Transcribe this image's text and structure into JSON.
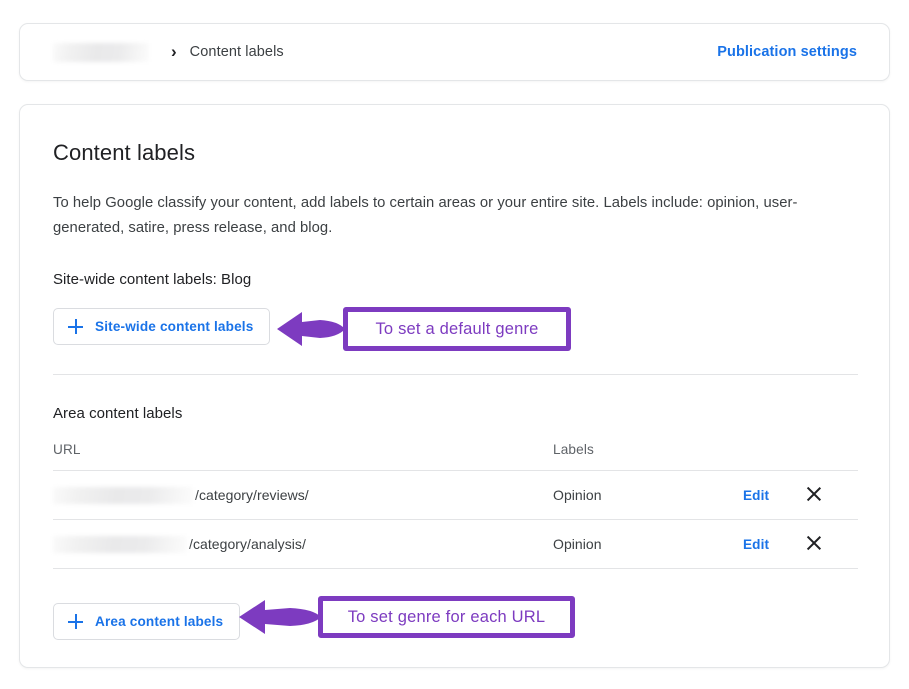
{
  "breadcrumb": {
    "redacted_site": "",
    "separator": "›",
    "current": "Content labels",
    "publication_settings": "Publication settings"
  },
  "content": {
    "title": "Content labels",
    "intro": "To help Google classify your content, add labels to certain areas or your entire site. Labels include: opinion, user-generated, satire, press release, and blog.",
    "sitewide_heading": "Site-wide content labels: Blog",
    "sitewide_button": "Site-wide content labels",
    "area_heading": "Area content labels",
    "area_button": "Area content labels"
  },
  "table": {
    "columns": [
      "URL",
      "Labels"
    ],
    "rows": [
      {
        "url_path": "/category/reviews/",
        "label": "Opinion",
        "edit": "Edit",
        "delete_icon": "close-icon"
      },
      {
        "url_path": "/category/analysis/",
        "label": "Opinion",
        "edit": "Edit",
        "delete_icon": "close-icon"
      }
    ]
  },
  "annotations": [
    {
      "text": "To set a default genre"
    },
    {
      "text": "To set genre for each URL"
    }
  ],
  "colors": {
    "link_blue": "#1a73e8",
    "annotation_purple": "#7d3bc0",
    "text_primary": "#202124",
    "text_secondary": "#3c4043",
    "border": "#dadce0"
  }
}
